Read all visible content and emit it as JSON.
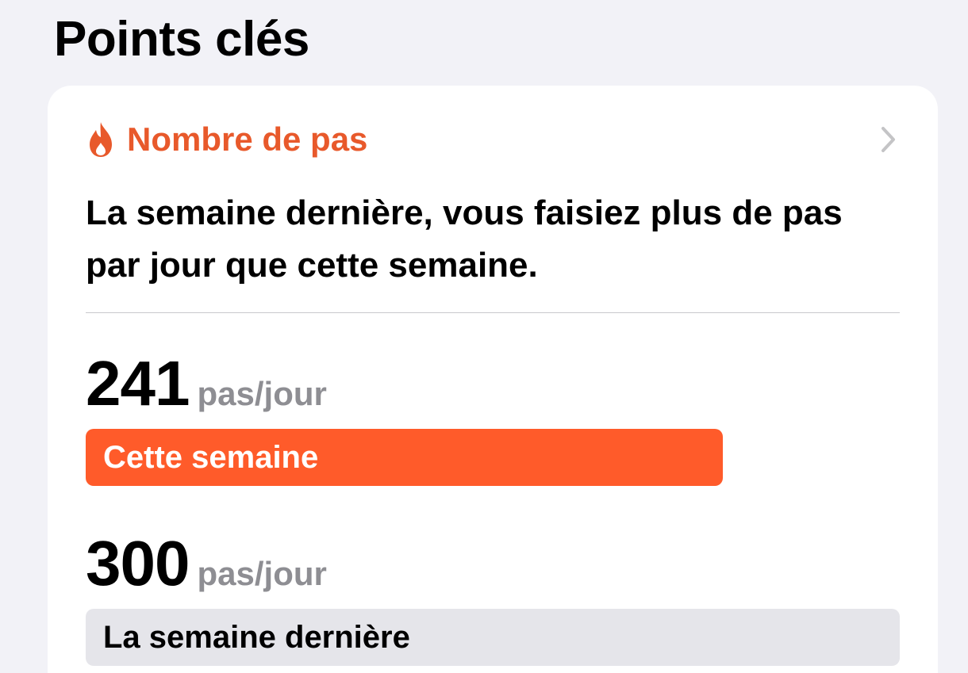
{
  "section": {
    "title": "Points clés"
  },
  "card": {
    "icon": "flame-icon",
    "label": "Nombre de pas",
    "summary": "La semaine dernière, vous faisiez plus de pas par jour que cette semaine.",
    "accent_color": "#e8592b"
  },
  "current": {
    "value": "241",
    "unit": "pas/jour",
    "label": "Cette semaine",
    "numeric_value": 241,
    "color": "#ff5b2a"
  },
  "previous": {
    "value": "300",
    "unit": "pas/jour",
    "label": "La semaine dernière",
    "numeric_value": 300,
    "color": "#e5e5ea"
  },
  "max_value": 300
}
